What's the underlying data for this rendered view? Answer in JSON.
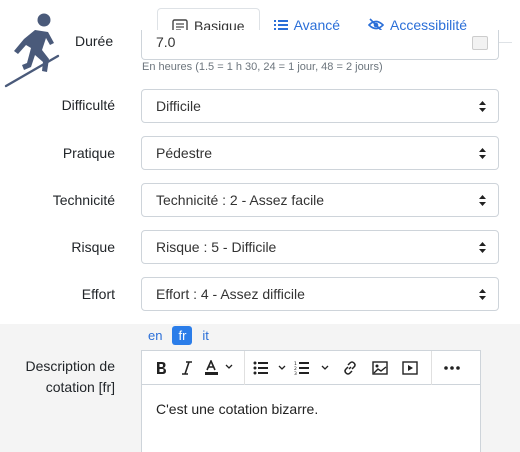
{
  "tabs": [
    {
      "label": "Basique",
      "icon": "form-icon",
      "active": true
    },
    {
      "label": "Avancé",
      "icon": "list-icon",
      "active": false
    },
    {
      "label": "Accessibilité",
      "icon": "eye-slash-icon",
      "active": false
    }
  ],
  "duree": {
    "label": "Durée",
    "value": "7.0",
    "hint": "En heures (1.5 = 1 h 30, 24 = 1 jour, 48 = 2 jours)"
  },
  "fields": [
    {
      "label": "Difficulté",
      "value": "Difficile"
    },
    {
      "label": "Pratique",
      "value": "Pédestre"
    },
    {
      "label": "Technicité",
      "value": "Technicité : 2 - Assez facile"
    },
    {
      "label": "Risque",
      "value": "Risque : 5 - Difficile"
    },
    {
      "label": "Effort",
      "value": "Effort : 4 - Assez difficile"
    }
  ],
  "languages": [
    "en",
    "fr",
    "it"
  ],
  "active_language": "fr",
  "description": {
    "label_line1": "Description de",
    "label_line2": "cotation [fr]",
    "content": "C'est une cotation bizarre."
  },
  "colors": {
    "accent": "#2b6fd8",
    "logo": "#4a5a7a"
  }
}
